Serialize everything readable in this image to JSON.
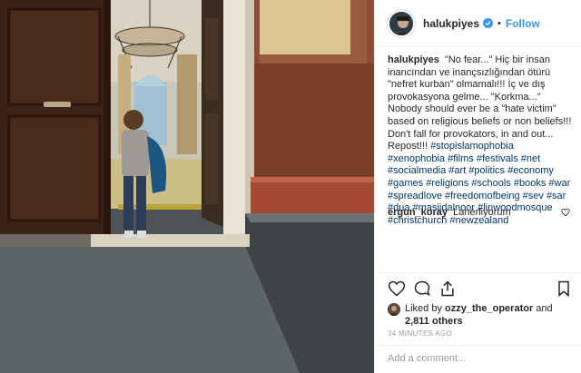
{
  "header": {
    "username": "halukpiyes",
    "separator": "•",
    "follow_label": "Follow"
  },
  "caption": {
    "username": "halukpiyes",
    "text": "\"No fear...\" Hiç bir insan inancından ve inançsızlığından ötürü \"nefret kurban\" olmamalı!!! İç ve dış provokasyona gelme... \"Korkma...\" Nobody should ever be a \"hate victim\" based on religious beliefs or non beliefs!!! Don't fall for provokators, in and out... Repost!!!",
    "hashtags": [
      "#stopislamophobia",
      "#xenophobia",
      "#films",
      "#festivals",
      "#net",
      "#socialmedia",
      "#art",
      "#politics",
      "#economy",
      "#games",
      "#religions",
      "#schools",
      "#books",
      "#war",
      "#spreadlove",
      "#freedomofbeing",
      "#sev",
      "#sar",
      "#dua",
      "#masjidalnoor",
      "#linwoodmosque",
      "#christchurch",
      "#newzealand"
    ]
  },
  "comment": {
    "username": "ergun_koray",
    "text": "Lanerliyorum"
  },
  "actions": {
    "like_icon": "heart-icon",
    "comment_icon": "comment-icon",
    "share_icon": "share-icon",
    "save_icon": "bookmark-icon"
  },
  "likes": {
    "prefix": "Liked by",
    "liker": "ozzy_the_operator",
    "middle": "and",
    "count": "2,811 others"
  },
  "timestamp": "34 minutes ago",
  "add_comment_placeholder": "Add a comment...",
  "colors": {
    "follow_blue": "#3897f0",
    "hashtag_navy": "#003569",
    "muted_gray": "#999999"
  }
}
